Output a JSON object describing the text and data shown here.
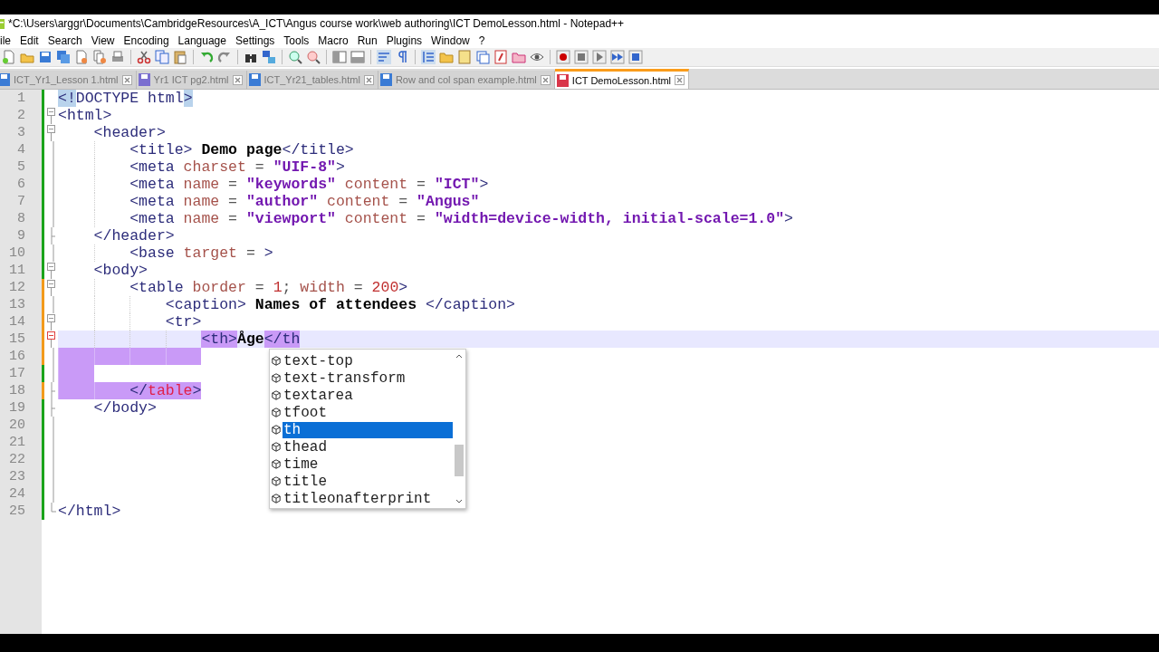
{
  "window": {
    "title": "*C:\\Users\\arggr\\Documents\\CambridgeResources\\A_ICT\\Angus course work\\web authoring\\ICT DemoLesson.html - Notepad++"
  },
  "menu": [
    "ile",
    "Edit",
    "Search",
    "View",
    "Encoding",
    "Language",
    "Settings",
    "Tools",
    "Macro",
    "Run",
    "Plugins",
    "Window",
    "?"
  ],
  "tabs": [
    {
      "label": "ICT_Yr1_Lesson 1.html",
      "modified": false,
      "readonly": false,
      "selected": false
    },
    {
      "label": "Yr1 ICT pg2.html",
      "modified": false,
      "readonly": true,
      "selected": false
    },
    {
      "label": "ICT_Yr21_tables.html",
      "modified": false,
      "readonly": false,
      "selected": false
    },
    {
      "label": "Row and col span example.html",
      "modified": false,
      "readonly": false,
      "selected": false
    },
    {
      "label": "ICT DemoLesson.html",
      "modified": true,
      "readonly": false,
      "selected": true
    }
  ],
  "editor": {
    "lines": [
      {
        "number": "1",
        "modified": false,
        "kind": "plain",
        "current": false,
        "tokens": [
          {
            "t": "<!",
            "kind": "tag",
            "matched_brace": true
          },
          {
            "t": "DOCTYPE html",
            "kind": "tag"
          },
          {
            "t": ">",
            "kind": "tag",
            "matched_brace": true
          }
        ]
      },
      {
        "number": "2",
        "modified": false,
        "kind": "fold-start",
        "current": false,
        "tokens": [
          {
            "t": "<html>",
            "kind": "tag"
          }
        ]
      },
      {
        "number": "3",
        "modified": false,
        "kind": "fold-start",
        "current": false,
        "indent": [
          {
            "highlighted": false
          }
        ],
        "tokens": [
          {
            "t": "<header>",
            "kind": "tag"
          }
        ]
      },
      {
        "number": "4",
        "modified": false,
        "kind": "fold-body",
        "current": false,
        "indent": [
          {
            "highlighted": false
          },
          {
            "highlighted": false
          }
        ],
        "tokens": [
          {
            "t": "<title> ",
            "kind": "tag"
          },
          {
            "t": "Demo page",
            "kind": "text"
          },
          {
            "t": "</title>",
            "kind": "tag"
          }
        ]
      },
      {
        "number": "5",
        "modified": false,
        "kind": "fold-body",
        "current": false,
        "indent": [
          {
            "highlighted": false
          },
          {
            "highlighted": false
          }
        ],
        "tokens": [
          {
            "t": "<meta ",
            "kind": "tag"
          },
          {
            "t": "charset",
            "kind": "attr"
          },
          {
            "t": " = ",
            "kind": "plain"
          },
          {
            "t": "\"UIF-8\"",
            "kind": "value"
          },
          {
            "t": ">",
            "kind": "tag"
          }
        ]
      },
      {
        "number": "6",
        "modified": false,
        "kind": "fold-body",
        "current": false,
        "indent": [
          {
            "highlighted": false
          },
          {
            "highlighted": false
          }
        ],
        "tokens": [
          {
            "t": "<meta ",
            "kind": "tag"
          },
          {
            "t": "name",
            "kind": "attr"
          },
          {
            "t": " = ",
            "kind": "plain"
          },
          {
            "t": "\"keywords\" ",
            "kind": "value"
          },
          {
            "t": "content",
            "kind": "attr"
          },
          {
            "t": " = ",
            "kind": "plain"
          },
          {
            "t": "\"ICT\"",
            "kind": "value"
          },
          {
            "t": ">",
            "kind": "tag"
          }
        ]
      },
      {
        "number": "7",
        "modified": false,
        "kind": "fold-body",
        "current": false,
        "indent": [
          {
            "highlighted": false
          },
          {
            "highlighted": false
          }
        ],
        "tokens": [
          {
            "t": "<meta ",
            "kind": "tag"
          },
          {
            "t": "name",
            "kind": "attr"
          },
          {
            "t": " = ",
            "kind": "plain"
          },
          {
            "t": "\"author\" ",
            "kind": "value"
          },
          {
            "t": "content",
            "kind": "attr"
          },
          {
            "t": " = ",
            "kind": "plain"
          },
          {
            "t": "\"Angus\"",
            "kind": "value"
          }
        ]
      },
      {
        "number": "8",
        "modified": false,
        "kind": "fold-body",
        "current": false,
        "indent": [
          {
            "highlighted": false
          },
          {
            "highlighted": false
          }
        ],
        "tokens": [
          {
            "t": "<meta ",
            "kind": "tag"
          },
          {
            "t": "name",
            "kind": "attr"
          },
          {
            "t": " = ",
            "kind": "plain"
          },
          {
            "t": "\"viewport\" ",
            "kind": "value"
          },
          {
            "t": "content",
            "kind": "attr"
          },
          {
            "t": " = ",
            "kind": "plain"
          },
          {
            "t": "\"width=device-width, initial-scale=1.0\"",
            "kind": "value"
          },
          {
            "t": ">",
            "kind": "tag"
          }
        ]
      },
      {
        "number": "9",
        "modified": false,
        "kind": "fold-end",
        "current": false,
        "indent": [
          {
            "highlighted": false
          }
        ],
        "tokens": [
          {
            "t": "</header>",
            "kind": "tag"
          }
        ]
      },
      {
        "number": "10",
        "modified": false,
        "kind": "fold-body",
        "current": false,
        "indent": [
          {
            "highlighted": false
          },
          {
            "highlighted": false
          }
        ],
        "tokens": [
          {
            "t": "<base ",
            "kind": "tag"
          },
          {
            "t": "target",
            "kind": "attr"
          },
          {
            "t": " = ",
            "kind": "plain"
          },
          {
            "t": ">",
            "kind": "tag"
          }
        ]
      },
      {
        "number": "11",
        "modified": false,
        "kind": "fold-start",
        "current": false,
        "indent": [
          {
            "highlighted": false
          }
        ],
        "tokens": [
          {
            "t": "<body>",
            "kind": "tag"
          }
        ]
      },
      {
        "number": "12",
        "modified": true,
        "kind": "fold-start",
        "current": false,
        "indent": [
          {
            "highlighted": false
          },
          {
            "highlighted": false
          }
        ],
        "tokens": [
          {
            "t": "<table ",
            "kind": "tag"
          },
          {
            "t": "border",
            "kind": "attr"
          },
          {
            "t": " = ",
            "kind": "plain"
          },
          {
            "t": "1",
            "kind": "number"
          },
          {
            "t": "; ",
            "kind": "plain"
          },
          {
            "t": "width",
            "kind": "attr"
          },
          {
            "t": " = ",
            "kind": "plain"
          },
          {
            "t": "200",
            "kind": "number"
          },
          {
            "t": ">",
            "kind": "tag"
          }
        ]
      },
      {
        "number": "13",
        "modified": true,
        "kind": "fold-body",
        "current": false,
        "indent": [
          {
            "highlighted": false
          },
          {
            "highlighted": false
          },
          {
            "highlighted": false
          }
        ],
        "tokens": [
          {
            "t": "<caption> ",
            "kind": "tag"
          },
          {
            "t": "Names of attendees ",
            "kind": "text"
          },
          {
            "t": "</caption>",
            "kind": "tag"
          }
        ]
      },
      {
        "number": "14",
        "modified": true,
        "kind": "fold-start",
        "current": false,
        "indent": [
          {
            "highlighted": false
          },
          {
            "highlighted": false
          },
          {
            "highlighted": false
          }
        ],
        "tokens": [
          {
            "t": "<tr>",
            "kind": "tag"
          }
        ]
      },
      {
        "number": "15",
        "modified": true,
        "kind": "fold-start",
        "current": true,
        "indent": [
          {
            "highlighted": false
          },
          {
            "highlighted": false
          },
          {
            "highlighted": false
          },
          {
            "highlighted": false
          }
        ],
        "tokens": [
          {
            "t": "<th>",
            "kind": "tag",
            "matched_tag": true
          },
          {
            "t": "Åge",
            "kind": "text"
          },
          {
            "t": "</th",
            "kind": "tag",
            "matched_tag": true
          }
        ]
      },
      {
        "number": "16",
        "modified": true,
        "kind": "fold-body",
        "current": false,
        "indent": [
          {
            "highlighted": true
          },
          {
            "highlighted": true
          },
          {
            "highlighted": true
          },
          {
            "highlighted": true
          }
        ]
      },
      {
        "number": "17",
        "modified": false,
        "kind": "fold-body",
        "current": false,
        "indent": [
          {
            "highlighted": true
          }
        ]
      },
      {
        "number": "18",
        "modified": true,
        "kind": "fold-end",
        "current": false,
        "indent": [
          {
            "highlighted": true
          },
          {
            "highlighted": true
          }
        ],
        "tokens": [
          {
            "t": "</",
            "kind": "tag",
            "matched_tag": true
          },
          {
            "t": "table",
            "kind": "error",
            "matched_tag": true
          },
          {
            "t": ">",
            "kind": "tag",
            "matched_tag": true
          }
        ]
      },
      {
        "number": "19",
        "modified": false,
        "kind": "fold-end",
        "current": false,
        "indent": [
          {
            "highlighted": false
          }
        ],
        "tokens": [
          {
            "t": "</body>",
            "kind": "tag"
          }
        ]
      },
      {
        "number": "20",
        "modified": false,
        "kind": "fold-body",
        "current": false
      },
      {
        "number": "21",
        "modified": false,
        "kind": "fold-body",
        "current": false
      },
      {
        "number": "22",
        "modified": false,
        "kind": "fold-body",
        "current": false
      },
      {
        "number": "23",
        "modified": false,
        "kind": "fold-body",
        "current": false
      },
      {
        "number": "24",
        "modified": false,
        "kind": "fold-body",
        "current": false
      },
      {
        "number": "25",
        "modified": false,
        "kind": "document-end",
        "current": false,
        "tokens": [
          {
            "t": "</html>",
            "kind": "tag"
          }
        ]
      }
    ]
  },
  "autocomplete": {
    "items": [
      {
        "label": "text-top",
        "selected": false
      },
      {
        "label": "text-transform",
        "selected": false
      },
      {
        "label": "textarea",
        "selected": false
      },
      {
        "label": "tfoot",
        "selected": false
      },
      {
        "label": "th",
        "selected": true
      },
      {
        "label": "thead",
        "selected": false
      },
      {
        "label": "time",
        "selected": false
      },
      {
        "label": "title",
        "selected": false
      },
      {
        "label": "titleonafterprint",
        "selected": false
      }
    ]
  }
}
